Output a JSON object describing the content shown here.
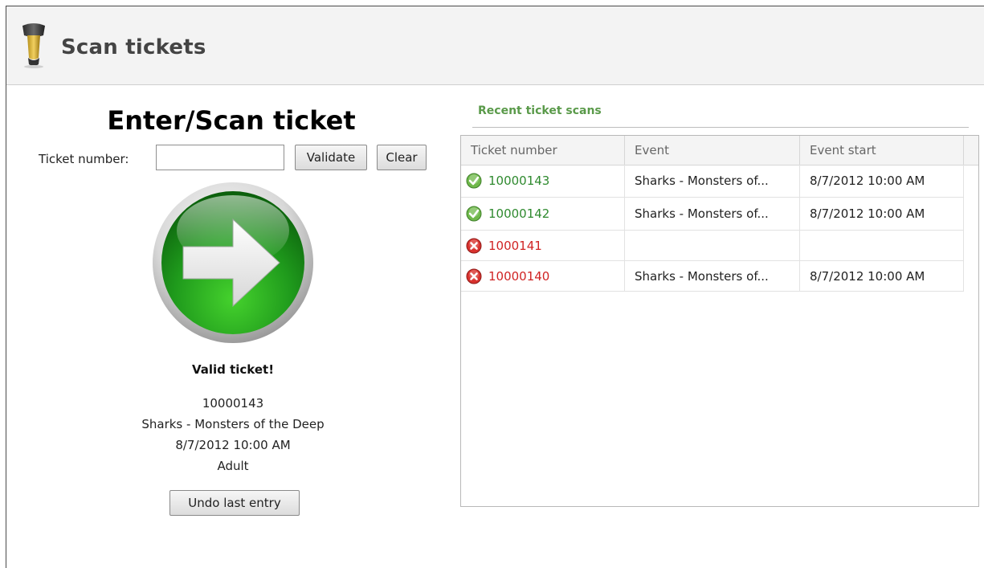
{
  "window": {
    "title": "Scan tickets",
    "icon": "barcode-scanner-icon"
  },
  "scan": {
    "heading": "Enter/Scan ticket",
    "ticket_label": "Ticket number:",
    "ticket_value": "",
    "validate_label": "Validate",
    "clear_label": "Clear",
    "status_icon": "green-arrow-icon",
    "result_title": "Valid ticket!",
    "result_number": "10000143",
    "result_event": "Sharks - Monsters of the Deep",
    "result_start": "8/7/2012 10:00 AM",
    "result_type": "Adult",
    "undo_label": "Undo last entry"
  },
  "recent": {
    "title": "Recent ticket scans",
    "columns": [
      "Ticket number",
      "Event",
      "Event start"
    ],
    "rows": [
      {
        "status": "valid",
        "icon": "check-icon",
        "ticket": "10000143",
        "event": "Sharks - Monsters of...",
        "start": "8/7/2012 10:00 AM"
      },
      {
        "status": "valid",
        "icon": "check-icon",
        "ticket": "10000142",
        "event": "Sharks - Monsters of...",
        "start": "8/7/2012 10:00 AM"
      },
      {
        "status": "invalid",
        "icon": "error-icon",
        "ticket": "1000141",
        "event": "",
        "start": ""
      },
      {
        "status": "invalid",
        "icon": "error-icon",
        "ticket": "10000140",
        "event": "Sharks - Monsters of...",
        "start": "8/7/2012 10:00 AM"
      }
    ]
  },
  "colors": {
    "valid": "#2f8a2f",
    "invalid": "#d02424",
    "section_title": "#5a9a4a"
  }
}
